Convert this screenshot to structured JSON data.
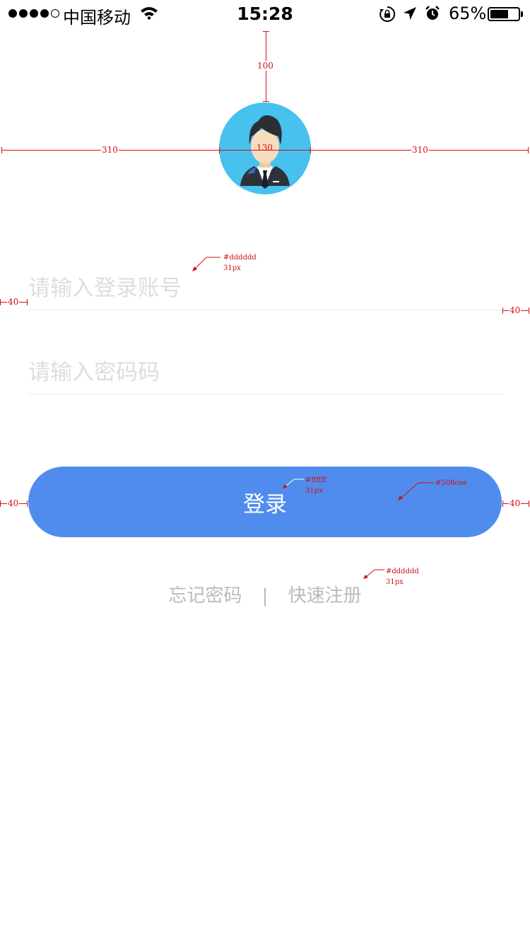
{
  "status_bar": {
    "carrier": "中国移动",
    "time": "15:28",
    "battery_percent": "65%",
    "battery_level": 0.65,
    "icons": [
      "signal-dots-icon",
      "wifi-icon",
      "rotation-lock-icon",
      "location-arrow-icon",
      "alarm-icon",
      "battery-icon"
    ]
  },
  "avatar": {
    "icon": "user-avatar-icon",
    "bg_color": "#47c1ee"
  },
  "form": {
    "account_placeholder": "请输入登录账号",
    "password_placeholder": "请输入密码码",
    "login_label": "登录"
  },
  "links": {
    "forgot": "忘记密码",
    "separator": "|",
    "register": "快速注册"
  },
  "annotations": {
    "top_gap": "100",
    "avatar_left": "310",
    "avatar_size": "130",
    "avatar_right": "310",
    "input_color": "#dddddd",
    "input_font": "31px",
    "margin_left": "40",
    "margin_right": "40",
    "btn_text_color": "#ffffff",
    "btn_text_font": "31px",
    "btn_color": "#508cee",
    "btn_margin_left": "40",
    "btn_margin_right": "40",
    "links_color": "#dddddd",
    "links_font": "31px"
  },
  "colors": {
    "primary": "#508cee",
    "placeholder": "#dddddd",
    "annotation": "#d01010"
  }
}
